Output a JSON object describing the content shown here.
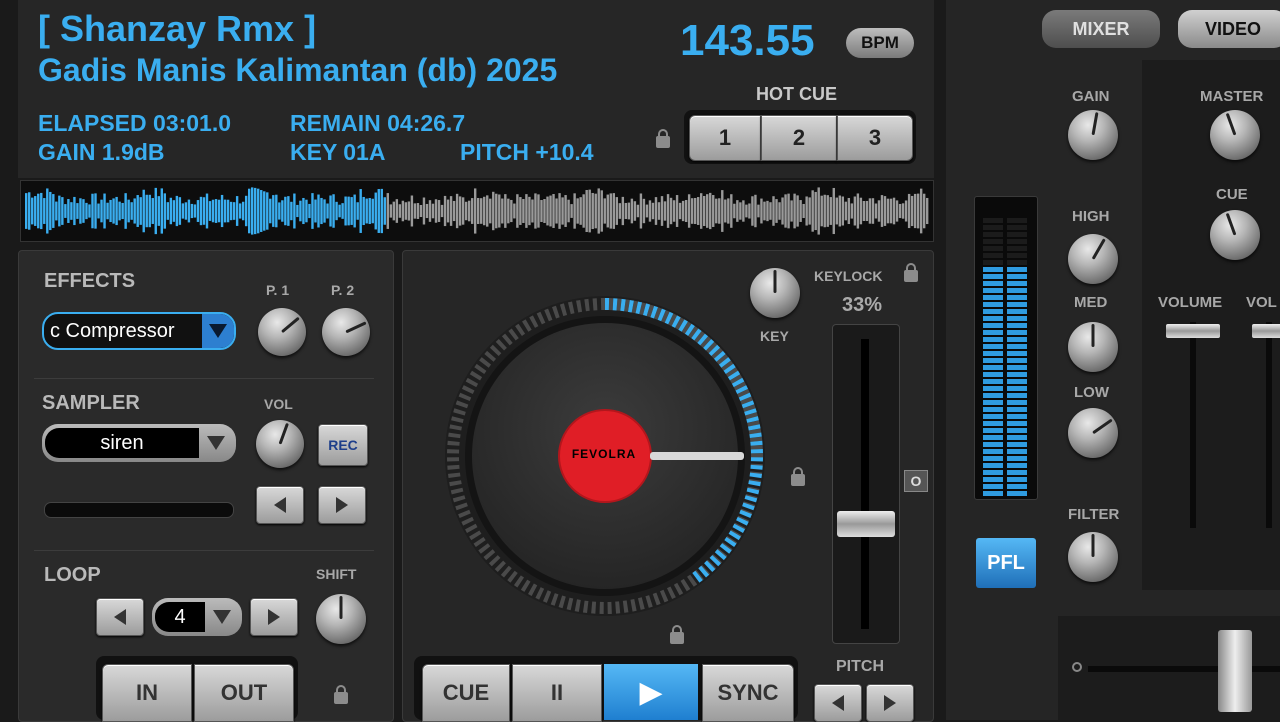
{
  "deck": {
    "artist": "[ Shanzay Rmx ]",
    "title": "Gadis Manis Kalimantan (db) 2025",
    "bpm": "143.55",
    "bpm_button": "BPM",
    "elapsed": "ELAPSED 03:01.0",
    "remain": "REMAIN 04:26.7",
    "gain": "GAIN 1.9dB",
    "key": "KEY 01A",
    "pitch": "PITCH +10.4",
    "progress": 0.4
  },
  "hot_cue": {
    "label": "HOT CUE",
    "buttons": [
      "1",
      "2",
      "3"
    ]
  },
  "effects": {
    "label": "EFFECTS",
    "selected": "c Compressor",
    "p1_label": "P. 1",
    "p2_label": "P. 2"
  },
  "sampler": {
    "label": "SAMPLER",
    "selected": "siren",
    "vol_label": "VOL",
    "rec_label": "REC"
  },
  "loop": {
    "label": "LOOP",
    "value": "4",
    "shift_label": "SHIFT",
    "in_label": "IN",
    "out_label": "OUT"
  },
  "platter": {
    "key_label": "KEY",
    "keylock_label": "KEYLOCK",
    "keylock_value": "33%",
    "pitch_label": "PITCH",
    "label_text": "FEVOLRA",
    "zero_label": "O"
  },
  "transport": {
    "cue": "CUE",
    "pause": "II",
    "play": "▶",
    "sync": "SYNC"
  },
  "mixer": {
    "tab_mixer": "MIXER",
    "tab_video": "VIDEO",
    "gain": "GAIN",
    "high": "HIGH",
    "med": "MED",
    "low": "LOW",
    "filter": "FILTER",
    "master": "MASTER",
    "cue": "CUE",
    "volume": "VOLUME",
    "volume2": "VOL",
    "pfl": "PFL"
  },
  "colors": {
    "accent": "#3aaef0",
    "platter_label": "#e01e26"
  }
}
